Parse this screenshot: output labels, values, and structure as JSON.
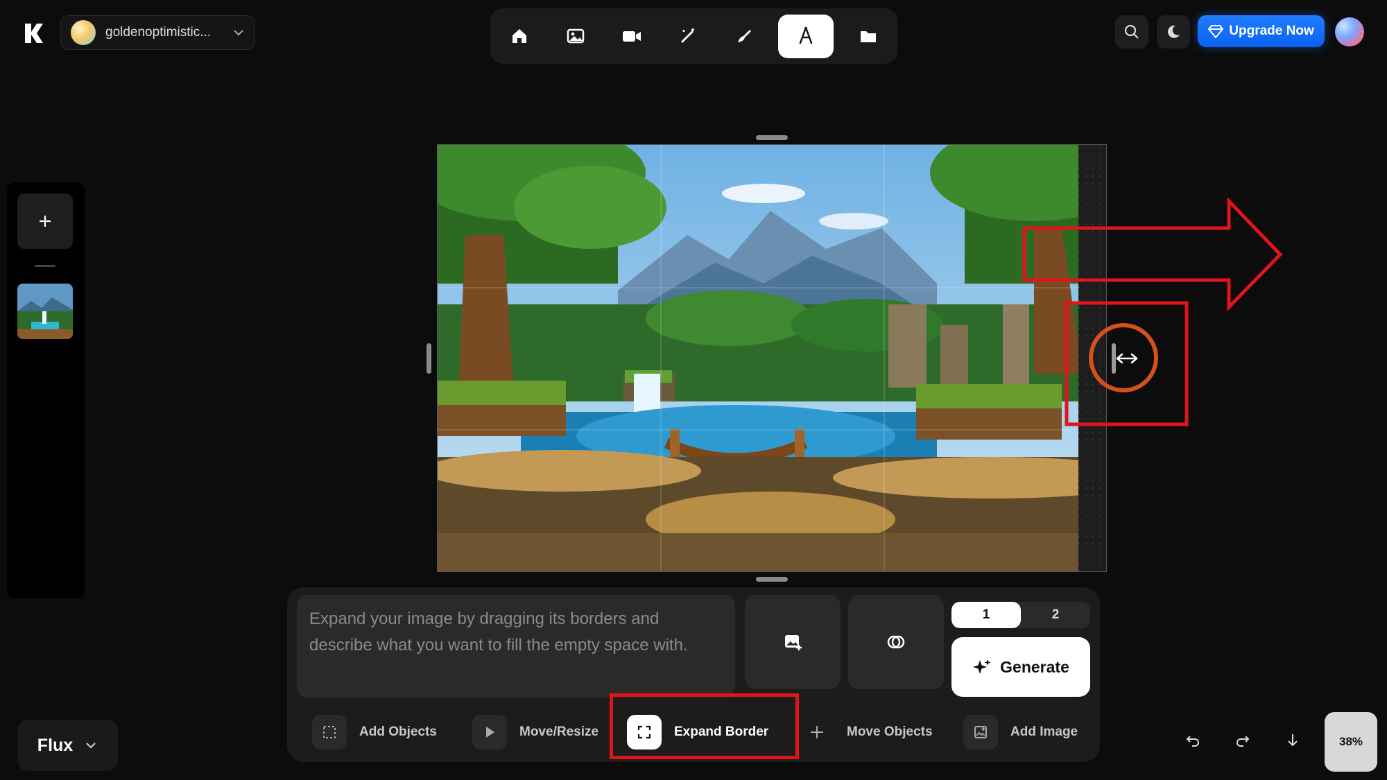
{
  "header": {
    "account_name": "goldenoptimistic...",
    "upgrade_label": "Upgrade Now",
    "toolbar_icons": [
      "home-icon",
      "image-icon",
      "video-icon",
      "magic-wand-icon",
      "brush-icon",
      "pen-nib-icon",
      "folder-icon"
    ],
    "active_tool": "pen-nib-icon"
  },
  "prompt": {
    "placeholder": "Expand your image by dragging its borders and describe what you want to fill the empty space with."
  },
  "count": {
    "options": [
      "1",
      "2"
    ],
    "selected": "1"
  },
  "generate_label": "Generate",
  "modes": {
    "add_objects": "Add Objects",
    "move_resize": "Move/Resize",
    "expand_border": "Expand Border",
    "move_objects": "Move Objects",
    "add_image": "Add Image",
    "active": "Expand Border"
  },
  "model": {
    "label": "Flux"
  },
  "zoom": {
    "label": "38%"
  },
  "colors": {
    "accent": "#1f7cff",
    "annotation": "#e0151b",
    "ring": "#d4511c"
  }
}
